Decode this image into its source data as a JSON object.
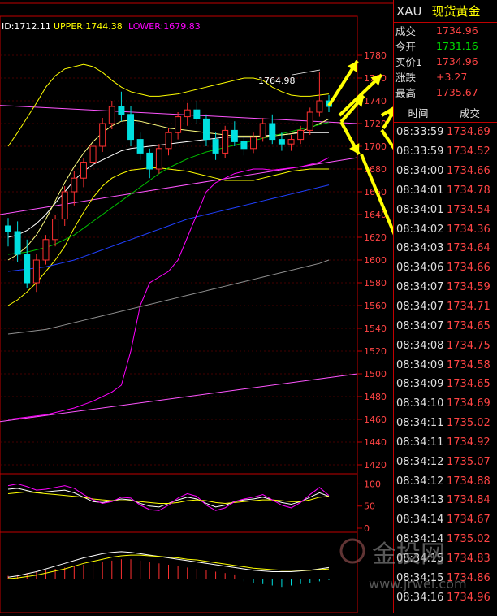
{
  "indicator_header": {
    "mid": "ID:1712.11",
    "upper": "UPPER:1744.38",
    "lower": "LOWER:1679.83"
  },
  "annotation": "1764.98",
  "price_axis": [
    "1780",
    "1760",
    "1740",
    "1720",
    "1700",
    "1680",
    "1660",
    "1640",
    "1620",
    "1600",
    "1580",
    "1560",
    "1540",
    "1520",
    "1500",
    "1480",
    "1460",
    "1440",
    "1420"
  ],
  "osc_axis": [
    "100",
    "50",
    "0"
  ],
  "quote": {
    "symbol": "XAU",
    "name": "现货黄金",
    "rows": [
      {
        "label": "成交",
        "value": "1734.96",
        "color": "#ff4444"
      },
      {
        "label": "今开",
        "value": "1731.16",
        "color": "#00e000"
      },
      {
        "label": "买价1",
        "value": "1734.96",
        "color": "#ff4444"
      },
      {
        "label": "涨跌",
        "value": "+3.27",
        "color": "#ff4444"
      },
      {
        "label": "最高",
        "value": "1735.67",
        "color": "#ff4444"
      }
    ],
    "ticks_header": {
      "time": "时间",
      "price": "成交"
    },
    "ticks": [
      {
        "time": "08:33:59",
        "price": "1734.69"
      },
      {
        "time": "08:33:59",
        "price": "1734.52"
      },
      {
        "time": "08:34:00",
        "price": "1734.66"
      },
      {
        "time": "08:34:01",
        "price": "1734.78"
      },
      {
        "time": "08:34:01",
        "price": "1734.54"
      },
      {
        "time": "08:34:02",
        "price": "1734.36"
      },
      {
        "time": "08:34:03",
        "price": "1734.64"
      },
      {
        "time": "08:34:06",
        "price": "1734.66"
      },
      {
        "time": "08:34:07",
        "price": "1734.59"
      },
      {
        "time": "08:34:07",
        "price": "1734.71"
      },
      {
        "time": "08:34:07",
        "price": "1734.65"
      },
      {
        "time": "08:34:08",
        "price": "1734.75"
      },
      {
        "time": "08:34:09",
        "price": "1734.58"
      },
      {
        "time": "08:34:09",
        "price": "1734.65"
      },
      {
        "time": "08:34:10",
        "price": "1734.69"
      },
      {
        "time": "08:34:11",
        "price": "1735.02"
      },
      {
        "time": "08:34:11",
        "price": "1734.92"
      },
      {
        "time": "08:34:12",
        "price": "1735.07"
      },
      {
        "time": "08:34:12",
        "price": "1734.88"
      },
      {
        "time": "08:34:13",
        "price": "1734.84"
      },
      {
        "time": "08:34:14",
        "price": "1734.67"
      },
      {
        "time": "08:34:14",
        "price": "1735.02"
      },
      {
        "time": "08:34:15",
        "price": "1734.83"
      },
      {
        "time": "08:34:15",
        "price": "1734.86"
      },
      {
        "time": "08:34:16",
        "price": "1734.96"
      }
    ]
  },
  "watermark": {
    "brand": "金投网",
    "url": "www.jrwei.com"
  },
  "chart_data": {
    "type": "candlestick",
    "ylim": [
      1420,
      1790
    ],
    "candles": [
      [
        1630,
        1637,
        1612,
        1625
      ],
      [
        1625,
        1634,
        1598,
        1605
      ],
      [
        1605,
        1618,
        1575,
        1580
      ],
      [
        1580,
        1605,
        1572,
        1600
      ],
      [
        1600,
        1622,
        1596,
        1618
      ],
      [
        1618,
        1640,
        1612,
        1636
      ],
      [
        1636,
        1665,
        1630,
        1660
      ],
      [
        1660,
        1678,
        1648,
        1672
      ],
      [
        1672,
        1690,
        1664,
        1686
      ],
      [
        1686,
        1705,
        1680,
        1700
      ],
      [
        1700,
        1725,
        1695,
        1720
      ],
      [
        1720,
        1740,
        1715,
        1735
      ],
      [
        1735,
        1748,
        1722,
        1728
      ],
      [
        1728,
        1735,
        1700,
        1706
      ],
      [
        1706,
        1712,
        1688,
        1694
      ],
      [
        1694,
        1698,
        1672,
        1680
      ],
      [
        1680,
        1702,
        1676,
        1698
      ],
      [
        1698,
        1716,
        1692,
        1712
      ],
      [
        1712,
        1730,
        1706,
        1726
      ],
      [
        1726,
        1738,
        1718,
        1732
      ],
      [
        1732,
        1740,
        1720,
        1724
      ],
      [
        1724,
        1728,
        1700,
        1706
      ],
      [
        1706,
        1712,
        1688,
        1694
      ],
      [
        1694,
        1718,
        1690,
        1714
      ],
      [
        1714,
        1722,
        1700,
        1704
      ],
      [
        1704,
        1708,
        1692,
        1698
      ],
      [
        1698,
        1712,
        1694,
        1708
      ],
      [
        1708,
        1725,
        1704,
        1720
      ],
      [
        1720,
        1728,
        1702,
        1706
      ],
      [
        1706,
        1712,
        1696,
        1702
      ],
      [
        1702,
        1710,
        1696,
        1706
      ],
      [
        1706,
        1718,
        1702,
        1714
      ],
      [
        1714,
        1734,
        1710,
        1730
      ],
      [
        1730,
        1765,
        1726,
        1740
      ],
      [
        1740,
        1745,
        1730,
        1735
      ]
    ],
    "bands": {
      "upper": [
        1700,
        1712,
        1725,
        1738,
        1752,
        1762,
        1768,
        1770,
        1772,
        1770,
        1765,
        1758,
        1752,
        1748,
        1746,
        1744,
        1744,
        1745,
        1746,
        1748,
        1750,
        1752,
        1754,
        1756,
        1758,
        1760,
        1760,
        1758,
        1752,
        1748,
        1745,
        1744,
        1744,
        1745,
        1746
      ],
      "mid": [
        1620,
        1622,
        1626,
        1632,
        1640,
        1650,
        1660,
        1670,
        1678,
        1684,
        1688,
        1692,
        1696,
        1698,
        1699,
        1700,
        1701,
        1702,
        1703,
        1704,
        1705,
        1706,
        1707,
        1708,
        1708,
        1708,
        1708,
        1709,
        1710,
        1710,
        1711,
        1712,
        1712,
        1712,
        1712
      ],
      "lower": [
        1560,
        1565,
        1572,
        1580,
        1590,
        1600,
        1612,
        1628,
        1642,
        1655,
        1665,
        1672,
        1676,
        1679,
        1680,
        1681,
        1681,
        1680,
        1679,
        1678,
        1676,
        1674,
        1672,
        1670,
        1670,
        1670,
        1670,
        1672,
        1674,
        1676,
        1678,
        1679,
        1680,
        1680,
        1680
      ]
    },
    "ma": {
      "yellow": [
        1600,
        1605,
        1612,
        1622,
        1636,
        1652,
        1668,
        1682,
        1694,
        1704,
        1712,
        1718,
        1722,
        1723,
        1722,
        1720,
        1718,
        1716,
        1715,
        1714,
        1713,
        1712,
        1711,
        1710,
        1709,
        1709,
        1709,
        1709,
        1709,
        1710,
        1711,
        1713,
        1716,
        1720,
        1724
      ],
      "green": [
        1605,
        1606,
        1607,
        1609,
        1611,
        1614,
        1618,
        1622,
        1628,
        1634,
        1640,
        1646,
        1652,
        1658,
        1664,
        1670,
        1676,
        1681,
        1685,
        1689,
        1692,
        1695,
        1697,
        1699,
        1701,
        1703,
        1705,
        1707,
        1709,
        1711,
        1713,
        1715,
        1717,
        1719,
        1721
      ],
      "blue": [
        1590,
        1591,
        1592,
        1593,
        1594,
        1596,
        1598,
        1600,
        1603,
        1606,
        1609,
        1612,
        1615,
        1618,
        1621,
        1624,
        1627,
        1630,
        1633,
        1636,
        1638,
        1640,
        1642,
        1644,
        1646,
        1648,
        1650,
        1652,
        1654,
        1656,
        1658,
        1660,
        1662,
        1664,
        1666
      ],
      "gray": [
        1535,
        1536,
        1537,
        1538,
        1539,
        1541,
        1543,
        1545,
        1547,
        1549,
        1551,
        1553,
        1555,
        1557,
        1559,
        1561,
        1563,
        1565,
        1567,
        1569,
        1571,
        1573,
        1575,
        1577,
        1579,
        1581,
        1583,
        1585,
        1587,
        1589,
        1591,
        1593,
        1595,
        1597,
        1600
      ],
      "magenta": [
        1460,
        1461,
        1462,
        1463,
        1464,
        1466,
        1468,
        1470,
        1473,
        1476,
        1480,
        1484,
        1490,
        1520,
        1560,
        1580,
        1585,
        1590,
        1600,
        1620,
        1640,
        1660,
        1668,
        1672,
        1676,
        1678,
        1680,
        1680,
        1679,
        1680,
        1681,
        1682,
        1684,
        1686,
        1690
      ]
    },
    "trendlines": [
      {
        "from": [
          1736,
          0
        ],
        "to": [
          1720,
          1
        ],
        "color": "#ff55ff"
      },
      {
        "from": [
          1640,
          0
        ],
        "to": [
          1690,
          1
        ],
        "color": "#ff55ff"
      },
      {
        "from": [
          1458,
          0
        ],
        "to": [
          1500,
          1
        ],
        "color": "#ff55ff"
      }
    ],
    "oscillator": {
      "ylim": [
        0,
        110
      ],
      "white": [
        88,
        90,
        85,
        80,
        82,
        84,
        86,
        80,
        70,
        60,
        58,
        62,
        66,
        64,
        56,
        50,
        48,
        56,
        64,
        70,
        66,
        56,
        48,
        52,
        60,
        64,
        66,
        70,
        64,
        58,
        54,
        60,
        70,
        80,
        72
      ],
      "yellow": [
        78,
        80,
        82,
        80,
        78,
        76,
        74,
        72,
        70,
        66,
        64,
        62,
        62,
        62,
        60,
        58,
        56,
        56,
        58,
        62,
        64,
        62,
        58,
        56,
        58,
        60,
        62,
        64,
        64,
        62,
        60,
        60,
        64,
        70,
        72
      ],
      "magenta": [
        96,
        100,
        94,
        86,
        88,
        92,
        96,
        90,
        76,
        64,
        56,
        60,
        70,
        68,
        52,
        42,
        40,
        52,
        68,
        78,
        72,
        52,
        40,
        46,
        60,
        66,
        70,
        76,
        64,
        52,
        46,
        58,
        76,
        92,
        74
      ]
    },
    "macd": {
      "bars": [
        4,
        6,
        8,
        10,
        12,
        14,
        16,
        18,
        20,
        22,
        24,
        26,
        28,
        28,
        26,
        24,
        22,
        20,
        18,
        16,
        14,
        12,
        10,
        8,
        6,
        -4,
        -6,
        -8,
        -10,
        -12,
        -10,
        -8,
        -6,
        -4,
        -2
      ],
      "line1": [
        2,
        4,
        7,
        10,
        14,
        18,
        22,
        26,
        30,
        33,
        36,
        38,
        39,
        38,
        36,
        34,
        32,
        30,
        28,
        26,
        24,
        22,
        20,
        18,
        16,
        14,
        12,
        11,
        10,
        10,
        10,
        11,
        12,
        14,
        16
      ],
      "line2": [
        0,
        1,
        3,
        5,
        8,
        11,
        14,
        18,
        22,
        25,
        28,
        31,
        33,
        34,
        34,
        33,
        32,
        31,
        30,
        28,
        27,
        25,
        23,
        21,
        19,
        17,
        15,
        14,
        13,
        12,
        12,
        12,
        12,
        13,
        14
      ]
    }
  }
}
